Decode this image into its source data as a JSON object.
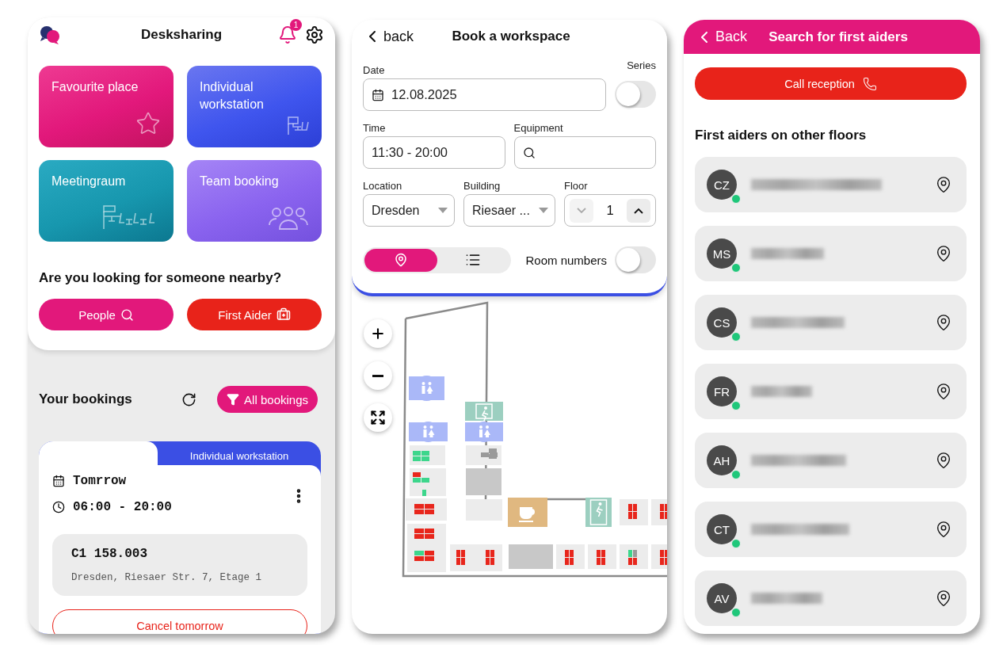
{
  "home": {
    "title": "Desksharing",
    "notifications": "1",
    "tiles": [
      {
        "label": "Favourite place",
        "kind": "favourite"
      },
      {
        "label": "Individual workstation",
        "kind": "workstation"
      },
      {
        "label": "Meetingraum",
        "kind": "meeting"
      },
      {
        "label": "Team booking",
        "kind": "team"
      }
    ],
    "nearby_heading": "Are you looking for someone nearby?",
    "nearby_buttons": [
      {
        "label": "People",
        "kind": "people"
      },
      {
        "label": "First Aider",
        "kind": "first_aid"
      }
    ],
    "bookings_heading": "Your bookings",
    "filter_button": "All bookings",
    "booking": {
      "type": "Individual workstation",
      "day": "Tomrrow",
      "time": "06:00 - 20:00",
      "room": "C1 158.003",
      "address": "Dresden, Riesaer Str. 7, Etage 1",
      "cancel": "Cancel tomorrow"
    }
  },
  "book": {
    "back": "back",
    "title": "Book a workspace",
    "date": {
      "label": "Date",
      "value": "12.08.2025"
    },
    "series": {
      "label": "Series",
      "on": false
    },
    "time": {
      "label": "Time",
      "value": "11:30 - 20:00"
    },
    "equipment": {
      "label": "Equipment"
    },
    "location": {
      "label": "Location",
      "value": "Dresden"
    },
    "building": {
      "label": "Building",
      "value": "Riesaer ..."
    },
    "floor": {
      "label": "Floor",
      "value": "1"
    },
    "views": [
      {
        "kind": "map",
        "selected": true
      },
      {
        "kind": "list",
        "selected": false
      }
    ],
    "room_numbers": {
      "label": "Room numbers",
      "on": false
    }
  },
  "first_aiders": {
    "back": "Back",
    "title": "Search for first aiders",
    "call_button": "Call reception",
    "heading": "First aiders on other floors",
    "people": [
      {
        "initials": "CZ",
        "online": true
      },
      {
        "initials": "MS",
        "online": true
      },
      {
        "initials": "CS",
        "online": true
      },
      {
        "initials": "FR",
        "online": true
      },
      {
        "initials": "AH",
        "online": true
      },
      {
        "initials": "CT",
        "online": true
      },
      {
        "initials": "AV",
        "online": true
      }
    ]
  }
}
